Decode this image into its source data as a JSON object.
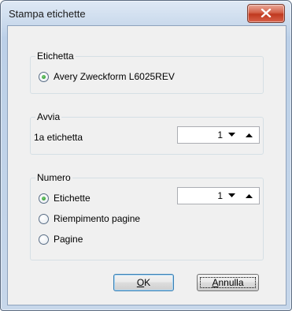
{
  "window": {
    "title": "Stampa etichette"
  },
  "etichetta": {
    "group_label": "Etichetta",
    "option_label": "Avery Zweckform L6025REV"
  },
  "avvia": {
    "group_label": "Avvia",
    "field_label": "1a etichetta",
    "value": "1"
  },
  "numero": {
    "group_label": "Numero",
    "options": [
      {
        "label": "Etichette",
        "selected": true
      },
      {
        "label": "Riempimento pagine",
        "selected": false
      },
      {
        "label": "Pagine",
        "selected": false
      }
    ],
    "value": "1"
  },
  "buttons": {
    "ok_mnemonic": "O",
    "ok_rest": "K",
    "cancel_mnemonic": "A",
    "cancel_rest": "nnulla"
  }
}
